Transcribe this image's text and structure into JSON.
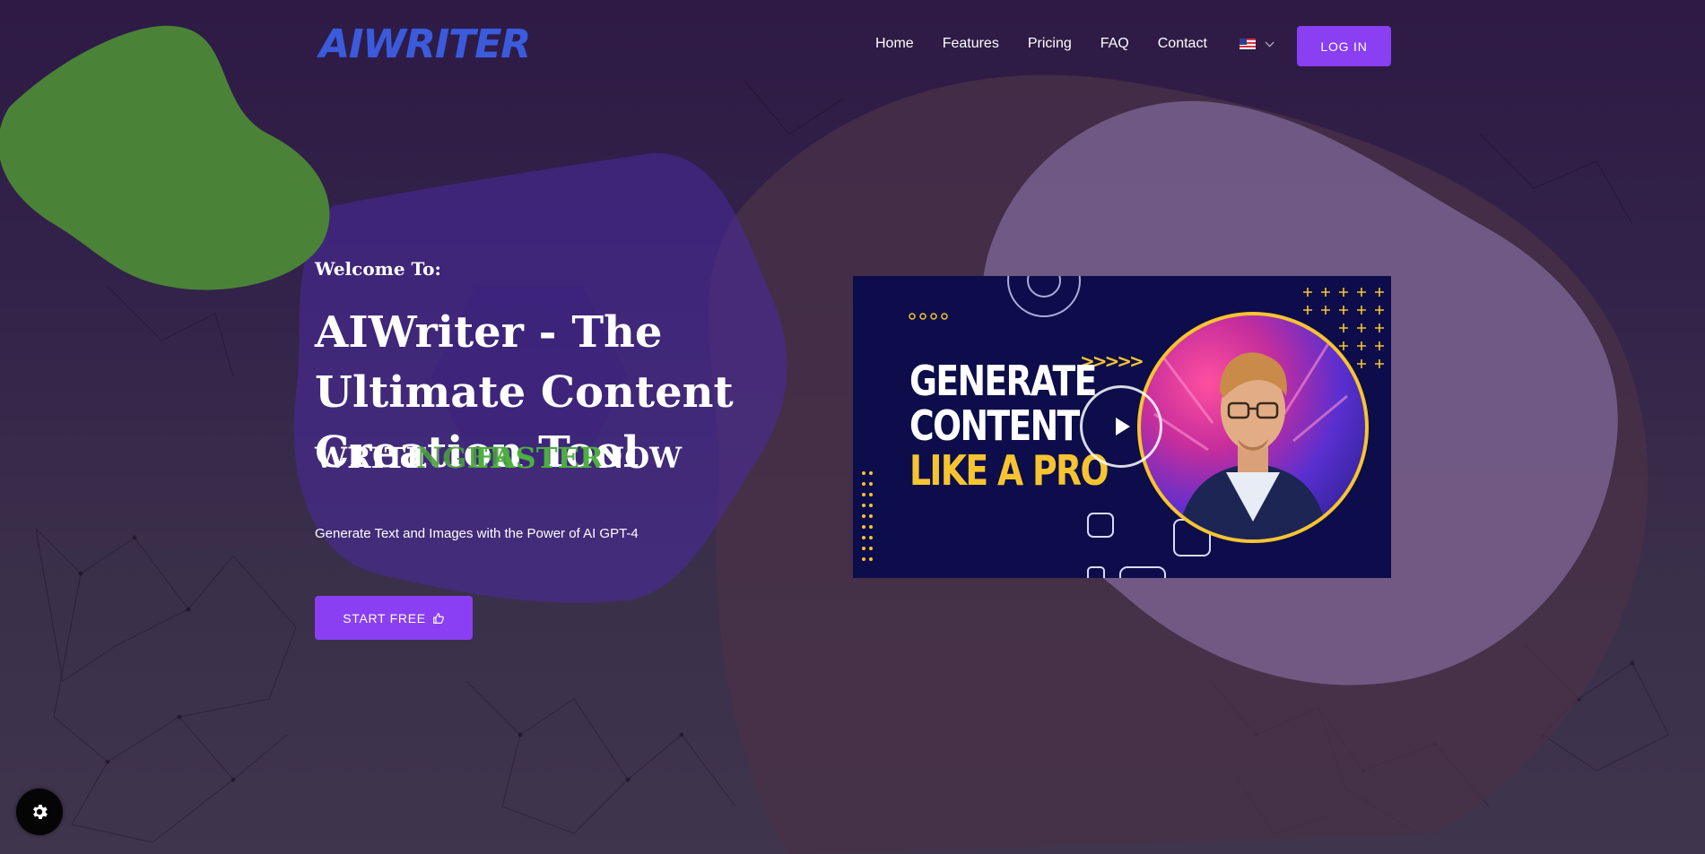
{
  "brand": {
    "logo_text": "AIWRITER"
  },
  "nav": {
    "items": [
      "Home",
      "Features",
      "Pricing",
      "FAQ",
      "Contact"
    ],
    "language_flag": "us-flag-icon",
    "login_label": "LOG IN"
  },
  "hero": {
    "welcome": "Welcome To:",
    "title": "AIWriter - The Ultimate Content Creation Tool",
    "write_prefix": "WRITE",
    "rotating_prev": "NGER",
    "rotating_current": "FASTER",
    "write_suffix": "NOW",
    "subtitle": "Generate Text and Images with the Power of AI GPT-4",
    "cta_label": "START FREE",
    "cta_icon": "thumbs-up-icon"
  },
  "video": {
    "line1": "GENERATE",
    "line2": "CONTENT",
    "line3": "LIKE A PRO",
    "arrows": ">>>>>",
    "play_icon": "play-icon"
  },
  "cookie": {
    "icon": "gear-icon"
  },
  "colors": {
    "accent": "#8a3ff2",
    "logo_blue": "#3b5bdb",
    "highlight_green": "#4caf3f",
    "video_bg": "#0c0d4a",
    "video_yellow": "#f7c431"
  }
}
